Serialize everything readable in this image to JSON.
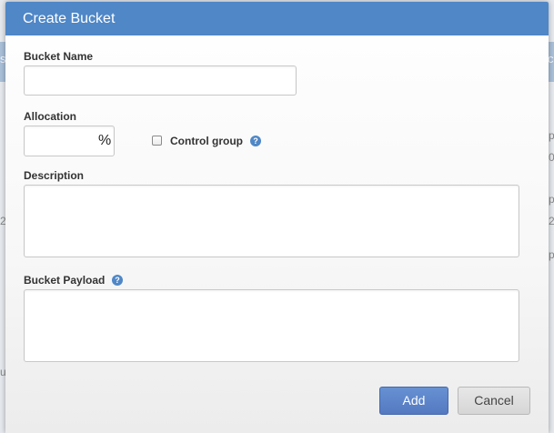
{
  "background": {
    "fragments_top": [
      "s",
      "c"
    ],
    "fragments_right": [
      "p",
      "0(",
      "p",
      "2",
      "p"
    ],
    "fragments_left": [
      "2",
      "u"
    ]
  },
  "dialog": {
    "title": "Create Bucket",
    "fields": {
      "bucket_name": {
        "label": "Bucket Name",
        "value": "",
        "placeholder": ""
      },
      "allocation": {
        "label": "Allocation",
        "value": "",
        "suffix": "%"
      },
      "control_group": {
        "label": "Control group",
        "checked": false,
        "help": "?"
      },
      "description": {
        "label": "Description",
        "value": ""
      },
      "bucket_payload": {
        "label": "Bucket Payload",
        "value": "",
        "help": "?"
      }
    },
    "buttons": {
      "add": "Add",
      "cancel": "Cancel"
    }
  },
  "colors": {
    "header": "#4f87c7",
    "primary_button": "#5b83c8",
    "help_icon": "#4f87c7"
  }
}
